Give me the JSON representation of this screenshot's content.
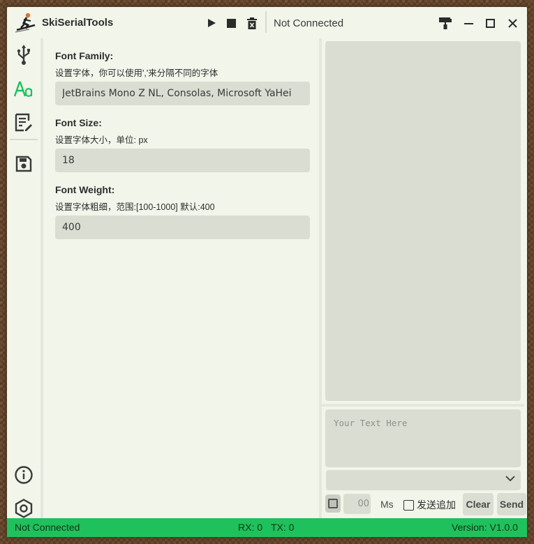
{
  "titlebar": {
    "app_title": "SkiSerialTools",
    "connection_status": "Not Connected",
    "icons": [
      "play-icon",
      "stop-icon",
      "clear-icon",
      "theme-icon",
      "minimize-icon",
      "maximize-icon",
      "close-icon"
    ]
  },
  "sidebar": {
    "items": [
      {
        "name": "usb",
        "icon": "usb-icon",
        "active": false
      },
      {
        "name": "font",
        "icon": "font-icon",
        "active": true
      },
      {
        "name": "log",
        "icon": "document-icon",
        "active": false
      },
      {
        "name": "save",
        "icon": "save-icon",
        "active": false
      }
    ],
    "bottom": [
      {
        "name": "info",
        "icon": "info-icon"
      },
      {
        "name": "settings",
        "icon": "settings-icon"
      }
    ]
  },
  "settings": {
    "font_family": {
      "label": "Font Family:",
      "description": "设置字体，你可以使用','来分隔不同的字体",
      "value": "JetBrains Mono Z NL, Consolas, Microsoft YaHei"
    },
    "font_size": {
      "label": "Font Size:",
      "description": "设置字体大小，单位: px",
      "value": "18"
    },
    "font_weight": {
      "label": "Font Weight:",
      "description": "设置字体粗细，范围:[100-1000] 默认:400",
      "value": "400"
    }
  },
  "send_panel": {
    "placeholder": "Your Text Here",
    "interval_value": "00",
    "interval_unit": "Ms",
    "append_label": "发送追加",
    "clear_label": "Clear",
    "send_label": "Send"
  },
  "statusbar": {
    "status": "Not Connected",
    "rx": "RX: 0",
    "tx": "TX: 0",
    "version": "Version: V1.0.0"
  },
  "colors": {
    "accent": "#1fc15c",
    "window_bg": "#f1f5ea",
    "input_bg": "#d9ddd2"
  }
}
